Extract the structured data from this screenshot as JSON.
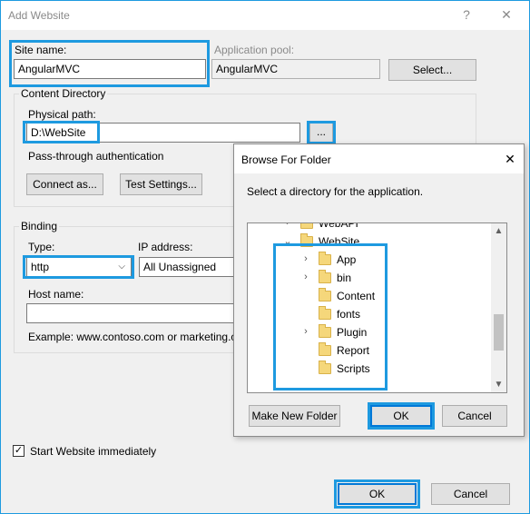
{
  "dialog": {
    "title": "Add Website",
    "help_glyph": "?",
    "close_glyph": "✕"
  },
  "site": {
    "site_name_label": "Site name:",
    "site_name_value": "AngularMVC",
    "app_pool_label": "Application pool:",
    "app_pool_value": "AngularMVC",
    "select_button": "Select..."
  },
  "content_directory": {
    "group_label": "Content Directory",
    "physical_path_label": "Physical path:",
    "physical_path_value": "D:\\WebSite",
    "browse_button": "...",
    "passthrough_label": "Pass-through authentication",
    "connect_as_button": "Connect as...",
    "test_settings_button": "Test Settings..."
  },
  "binding": {
    "group_label": "Binding",
    "type_label": "Type:",
    "type_value": "http",
    "ip_label": "IP address:",
    "ip_value": "All Unassigned",
    "host_label": "Host name:",
    "host_value": "",
    "example_text": "Example: www.contoso.com or marketing.c"
  },
  "start_immediately": {
    "label": "Start Website immediately",
    "checked": true,
    "check_glyph": "✓"
  },
  "footer": {
    "ok_button": "OK",
    "cancel_button": "Cancel"
  },
  "browse_dialog": {
    "title": "Browse For Folder",
    "close_glyph": "✕",
    "instruction": "Select a directory for the application.",
    "tree": [
      {
        "label": "WebAPI",
        "caret": "›",
        "expanded": false
      },
      {
        "label": "WebSite",
        "caret": "⌄",
        "expanded": true
      },
      {
        "label": "App",
        "caret": "›",
        "expanded": false
      },
      {
        "label": "bin",
        "caret": "›",
        "expanded": false
      },
      {
        "label": "Content",
        "caret": "",
        "expanded": false
      },
      {
        "label": "fonts",
        "caret": "",
        "expanded": false
      },
      {
        "label": "Plugin",
        "caret": "›",
        "expanded": false
      },
      {
        "label": "Report",
        "caret": "",
        "expanded": false
      },
      {
        "label": "Scripts",
        "caret": "",
        "expanded": false
      }
    ],
    "scroll_up_glyph": "▲",
    "scroll_down_glyph": "▼",
    "make_new_folder_button": "Make New Folder",
    "ok_button": "OK",
    "cancel_button": "Cancel"
  },
  "colors": {
    "highlight": "#1e9ae0",
    "dialog_bg": "#f0f0f0",
    "folder": "#f5d77b"
  }
}
